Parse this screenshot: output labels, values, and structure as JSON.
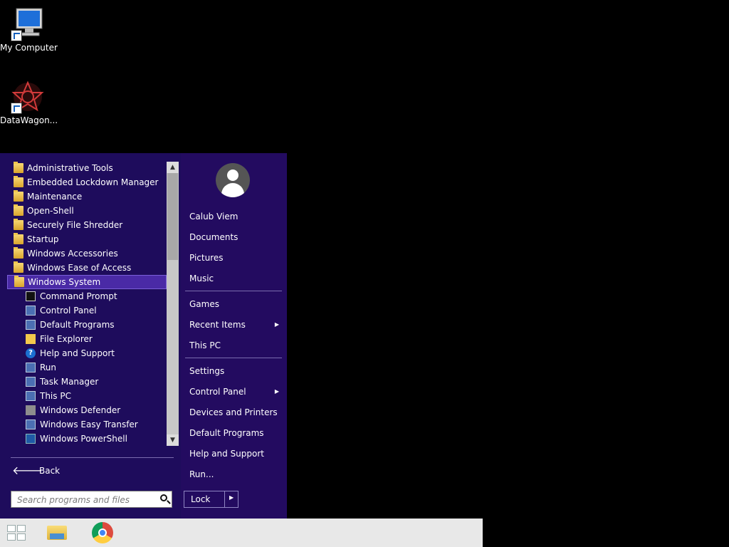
{
  "desktop": {
    "icons": [
      {
        "label": "My Computer",
        "icon": "computer-icon"
      },
      {
        "label": "DataWagon...",
        "icon": "app-icon"
      }
    ]
  },
  "start_menu": {
    "programs": [
      {
        "label": "Administrative Tools",
        "type": "folder"
      },
      {
        "label": "Embedded Lockdown Manager",
        "type": "folder"
      },
      {
        "label": "Maintenance",
        "type": "folder"
      },
      {
        "label": "Open-Shell",
        "type": "folder"
      },
      {
        "label": "Securely File Shredder",
        "type": "folder"
      },
      {
        "label": "Startup",
        "type": "folder"
      },
      {
        "label": "Windows Accessories",
        "type": "folder"
      },
      {
        "label": "Windows Ease of Access",
        "type": "folder"
      },
      {
        "label": "Windows System",
        "type": "folder",
        "selected": true
      },
      {
        "label": "Command Prompt",
        "type": "item"
      },
      {
        "label": "Control Panel",
        "type": "item"
      },
      {
        "label": "Default Programs",
        "type": "item"
      },
      {
        "label": "File Explorer",
        "type": "item"
      },
      {
        "label": "Help and Support",
        "type": "item"
      },
      {
        "label": "Run",
        "type": "item"
      },
      {
        "label": "Task Manager",
        "type": "item"
      },
      {
        "label": "This PC",
        "type": "item"
      },
      {
        "label": "Windows Defender",
        "type": "item"
      },
      {
        "label": "Windows Easy Transfer",
        "type": "item"
      },
      {
        "label": "Windows PowerShell",
        "type": "item"
      }
    ],
    "back_label": "Back",
    "search_placeholder": "Search programs and files",
    "user_name": "Calub Viem",
    "right_items": {
      "documents": "Documents",
      "pictures": "Pictures",
      "music": "Music",
      "games": "Games",
      "recent_items": "Recent Items",
      "this_pc": "This PC",
      "settings": "Settings",
      "control_panel": "Control Panel",
      "devices_printers": "Devices and Printers",
      "default_programs": "Default Programs",
      "help_support": "Help and Support",
      "run": "Run..."
    },
    "lock_label": "Lock"
  },
  "taskbar": {
    "items": [
      "start-button",
      "file-explorer",
      "chrome"
    ]
  }
}
